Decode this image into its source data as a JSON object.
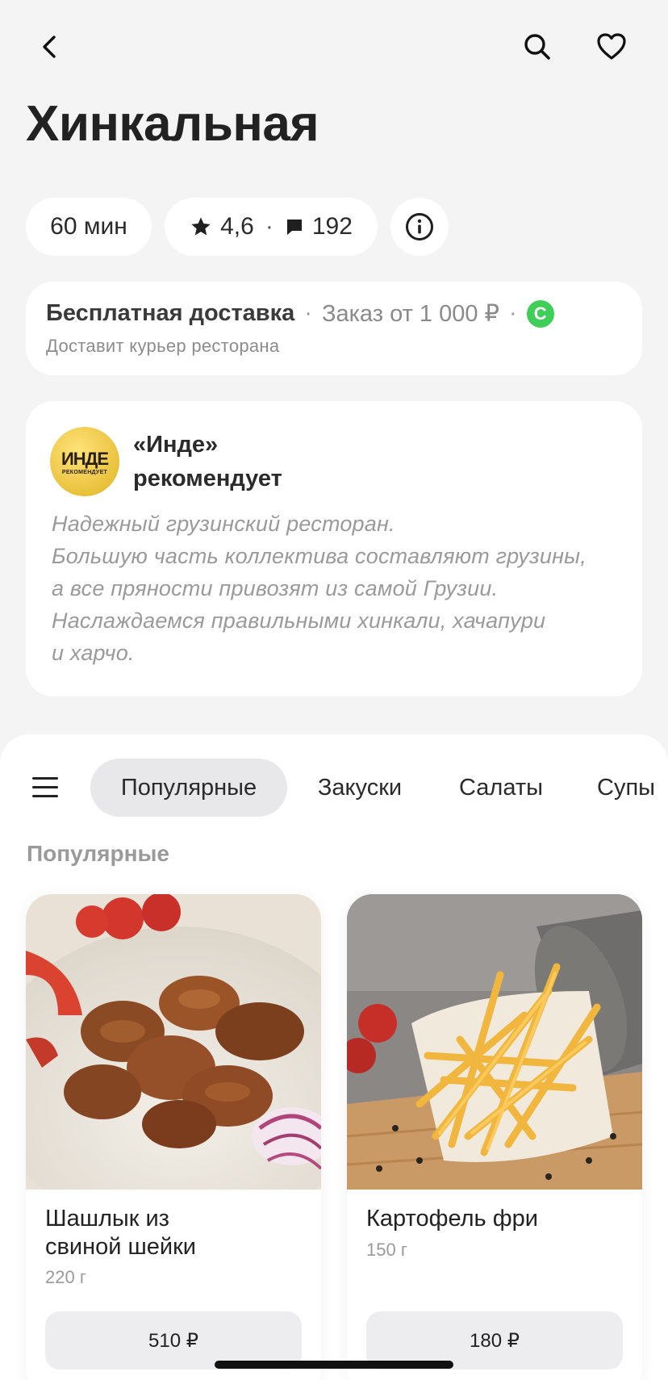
{
  "header": {
    "title": "Хинкальная"
  },
  "badges": {
    "delivery_time": "60 мин",
    "rating": "4,6",
    "rating_sep": "·",
    "reviews": "192"
  },
  "delivery": {
    "free": "Бесплатная доставка",
    "sep": "·",
    "min_order": "Заказ от 1 000 ₽",
    "cashback_letter": "С",
    "subtitle": "Доставит курьер ресторана",
    "accent": "#3fce57"
  },
  "recommendation": {
    "logo_main": "ИНДЕ",
    "logo_sub": "РЕКОМЕНДУЕТ",
    "title_line1": "«Инде»",
    "title_line2": "рекомендует",
    "text_lines": [
      "Надежный грузинский ресторан.",
      "Большую часть коллектива составляют грузины,",
      "а все пряности привозят из самой Грузии.",
      "Наслаждаемся правильными хинкали, хачапури",
      "и харчо."
    ]
  },
  "categories": {
    "tabs": [
      "Популярные",
      "Закуски",
      "Салаты",
      "Супы"
    ],
    "active": "Популярные"
  },
  "section": {
    "title": "Популярные"
  },
  "products": [
    {
      "name_line1": "Шашлык из",
      "name_line2": "свиной шейки",
      "weight": "220 г",
      "price": "510 ₽"
    },
    {
      "name_line1": "Картофель фри",
      "name_line2": "",
      "weight": "150 г",
      "price": "180 ₽"
    }
  ]
}
